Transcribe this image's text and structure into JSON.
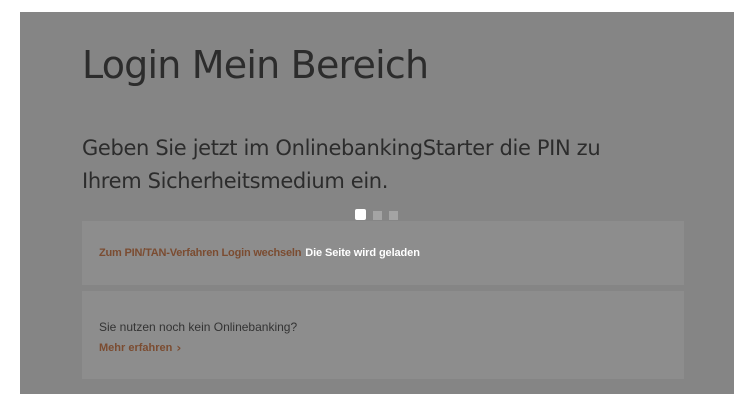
{
  "header": {
    "title": "Login Mein Bereich",
    "subtitle": "Geben Sie jetzt im OnlinebankingStarter die PIN zu Ihrem Sicherheitsmedium ein."
  },
  "login": {
    "switch_link": "Zum PIN/TAN-Verfahren Login wechseln",
    "loading_text": "Die Seite wird geladen"
  },
  "info": {
    "text": "Sie nutzen noch kein Onlinebanking?",
    "more_link": "Mehr erfahren",
    "more_icon": "chevron-right-icon"
  },
  "colors": {
    "overlay": "#858585",
    "card": "#8d8d8d",
    "accent": "#7b4c31",
    "text_dark": "#2c2c2c",
    "loading_text": "#ffffff"
  }
}
